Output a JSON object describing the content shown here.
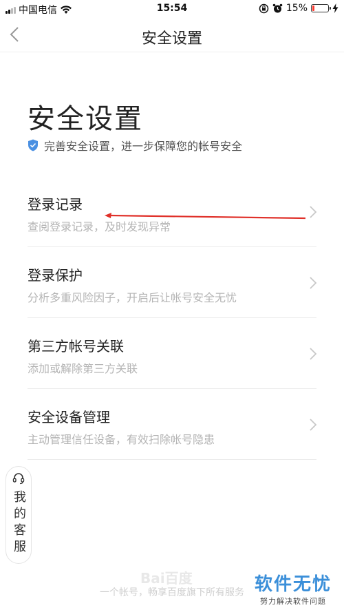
{
  "status_bar": {
    "carrier": "中国电信",
    "time": "15:54",
    "battery_percent_label": "15%",
    "battery_level": 0.15
  },
  "nav": {
    "title": "安全设置"
  },
  "header": {
    "heading": "安全设置",
    "subtitle": "完善安全设置，进一步保障您的帐号安全"
  },
  "menu": [
    {
      "title": "登录记录",
      "desc": "查阅登录记录，及时发现异常"
    },
    {
      "title": "登录保护",
      "desc": "分析多重风险因子，开启后让帐号安全无忧"
    },
    {
      "title": "第三方帐号关联",
      "desc": "添加或解除第三方关联"
    },
    {
      "title": "安全设备管理",
      "desc": "主动管理信任设备，有效扫除帐号隐患"
    }
  ],
  "customer_service": {
    "label": "我的客服"
  },
  "footer": {
    "logo_text": "Bai百度",
    "tagline": "一个帐号，畅享百度旗下所有服务"
  },
  "watermark": {
    "main": "软件无忧",
    "sub": "努力解决软件问题"
  },
  "colors": {
    "accent_blue": "#4a90e2",
    "annotation_red": "#e0312a",
    "battery_red": "#ff3b30",
    "watermark_blue": "#3b8fd9"
  },
  "icons": [
    "signal-icon",
    "wifi-icon",
    "lock-rotation-icon",
    "alarm-icon",
    "battery-icon",
    "charging-icon",
    "back-icon",
    "shield-icon",
    "chevron-right-icon",
    "headset-icon",
    "paw-icon"
  ]
}
